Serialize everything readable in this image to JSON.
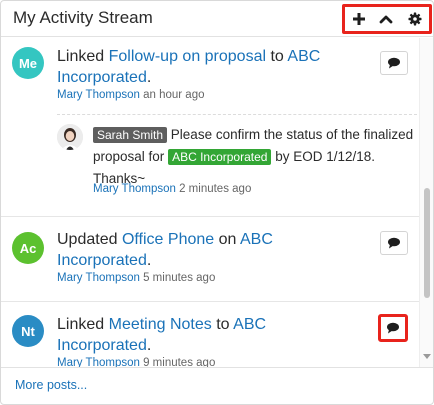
{
  "dashlet": {
    "title": "My Activity Stream"
  },
  "toolbar": {
    "add_icon": "plus-icon",
    "collapse_icon": "chevron-up-icon",
    "settings_icon": "gear-icon"
  },
  "entries": [
    {
      "avatar": "Me",
      "avatar_color": "#34c6c1",
      "verb": "Linked",
      "record": "Follow-up on proposal",
      "connector": "to",
      "target": "ABC Incorporated",
      "end": ".",
      "user": "Mary Thompson",
      "time": "an hour ago",
      "reply": {
        "mention": "Sarah Smith",
        "text_a": "Please confirm the status of the finalized proposal for",
        "account": "ABC Incorporated",
        "text_b": "by EOD 1/12/18. Thanks~",
        "user": "Mary Thompson",
        "time": "2 minutes ago"
      }
    },
    {
      "avatar": "Ac",
      "avatar_color": "#5cc12f",
      "verb": "Updated",
      "record": "Office Phone",
      "connector": "on",
      "target": "ABC Incorporated",
      "end": ".",
      "user": "Mary Thompson",
      "time": "5 minutes ago"
    },
    {
      "avatar": "Nt",
      "avatar_color": "#2a8cc4",
      "verb": "Linked",
      "record": "Meeting Notes",
      "connector": "to",
      "target": "ABC Incorporated",
      "end": ".",
      "user": "Mary Thompson",
      "time": "9 minutes ago"
    }
  ],
  "footer": {
    "more": "More posts..."
  },
  "colors": {
    "accent_link": "#1a72b8",
    "highlight": "#e8231c",
    "account_tag": "#33a635"
  }
}
